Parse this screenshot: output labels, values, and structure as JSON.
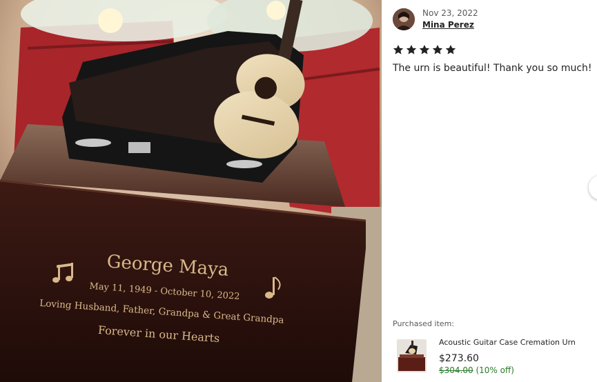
{
  "review": {
    "date": "Nov 23, 2022",
    "reviewer": "Mina Perez",
    "rating": 5,
    "text": "The urn is beautiful! Thank you so much!"
  },
  "photo": {
    "engraving": {
      "name": "George Maya",
      "dates": "May 11, 1949 - October 10, 2022",
      "relations": "Loving Husband, Father, Grandpa & Great Grandpa",
      "motto": "Forever in our Hearts"
    }
  },
  "purchased": {
    "label": "Purchased item:",
    "title": "Acoustic Guitar Case Cremation Urn",
    "price": "$273.60",
    "original_price": "$304.00",
    "discount": "(10% off)"
  },
  "colors": {
    "star": "#222222",
    "discount_green": "#2a7a2a"
  },
  "icons": {
    "star": "star-icon",
    "next": "chevron-right-icon"
  }
}
